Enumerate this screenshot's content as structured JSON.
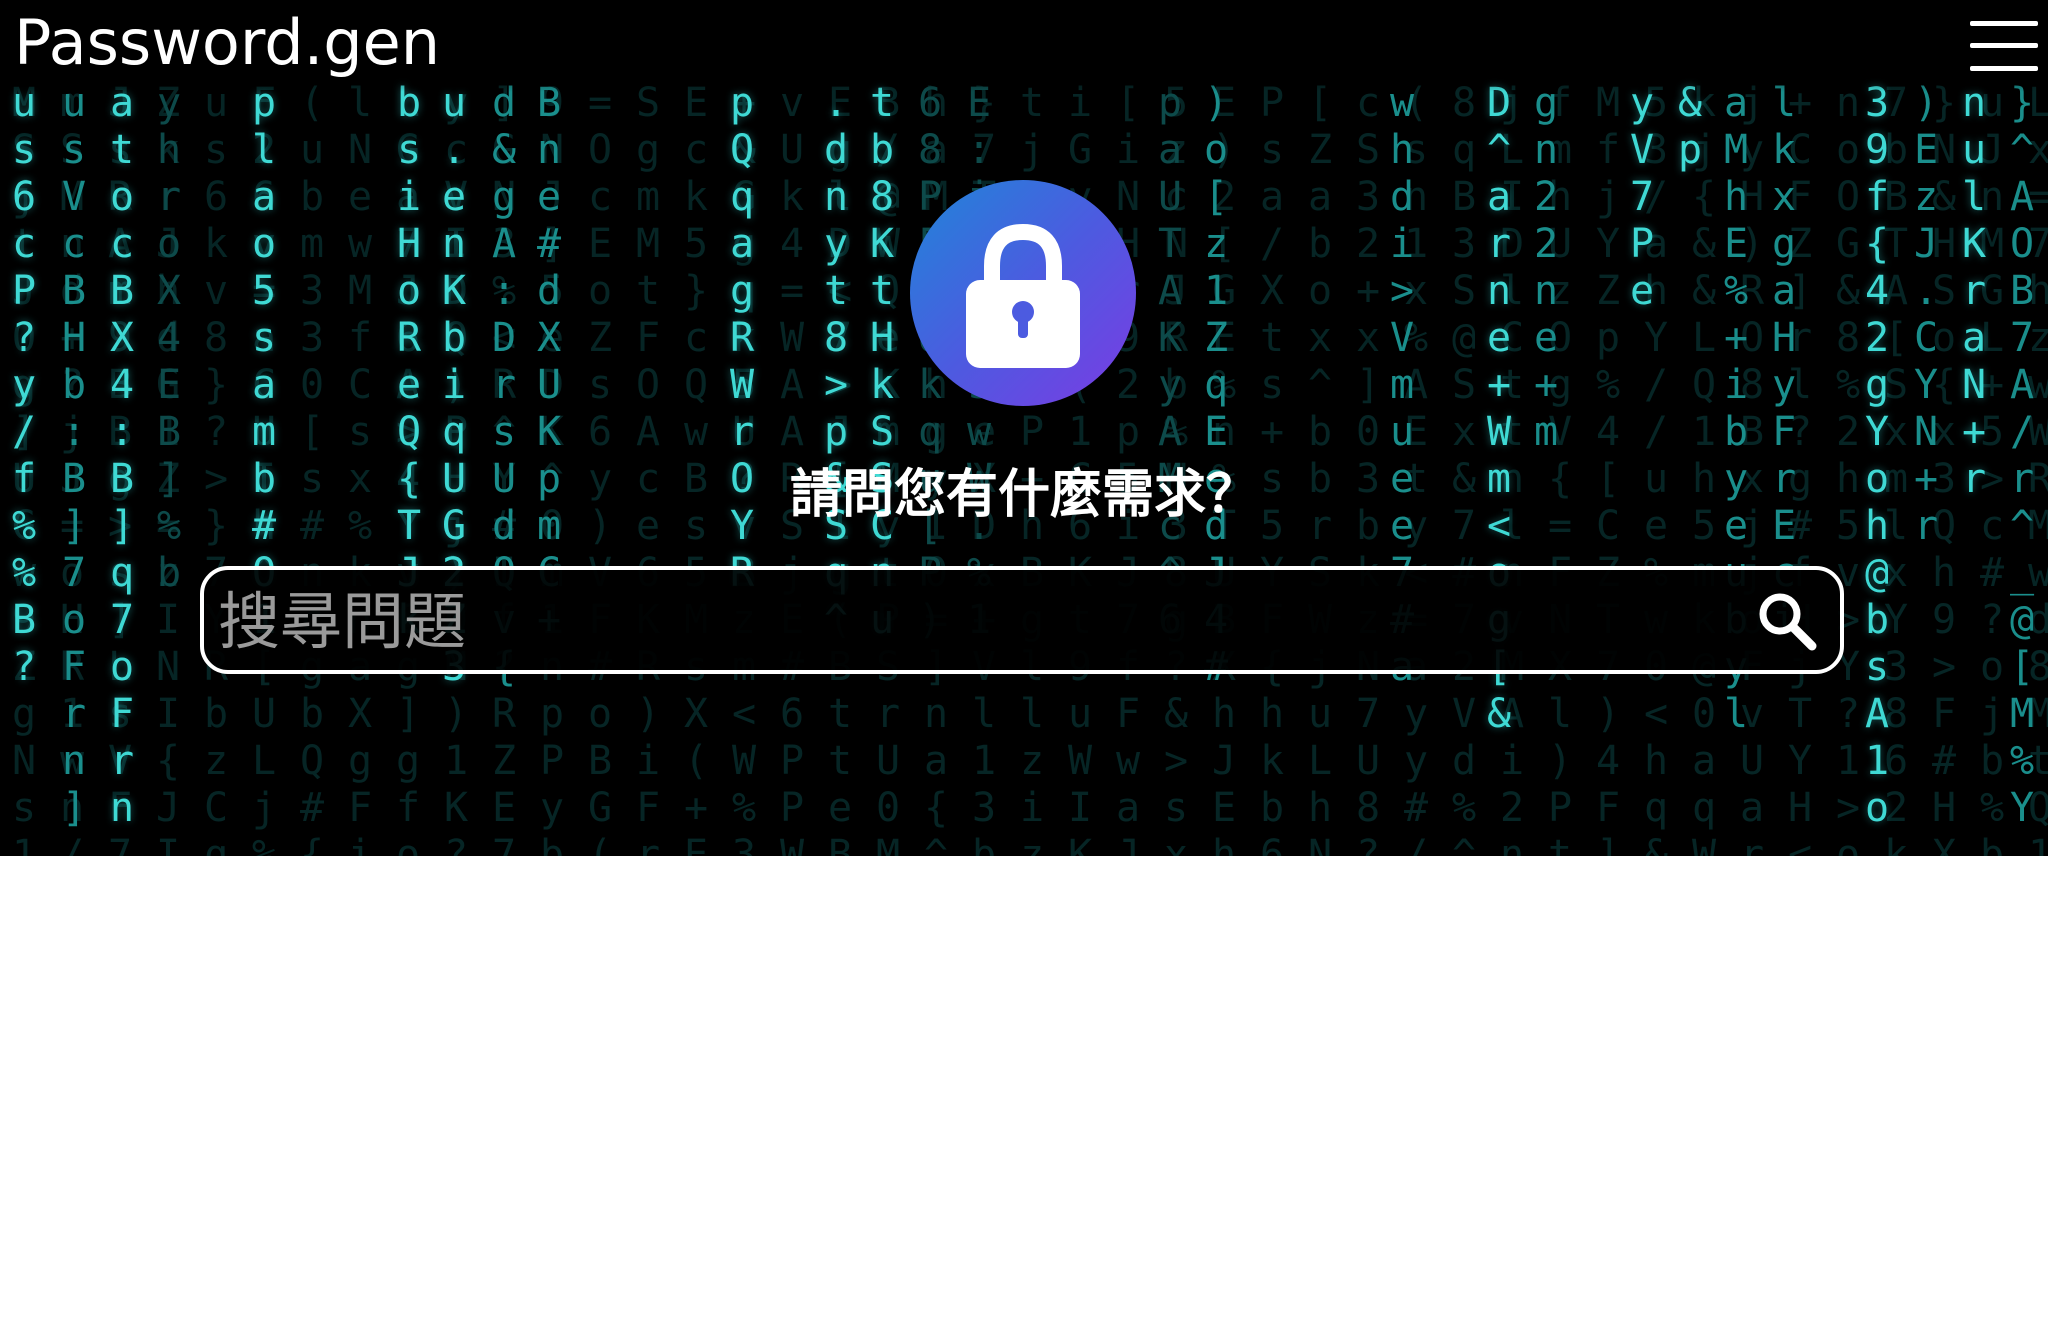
{
  "header": {
    "logo": "Password.gen",
    "menu_icon": "hamburger-menu-icon"
  },
  "hero": {
    "lock_icon": "padlock-icon",
    "question": "請問您有什麼需求？"
  },
  "search": {
    "placeholder": "搜尋問題",
    "value": "",
    "icon": "search-icon"
  },
  "colors": {
    "background": "#000000",
    "matrix_text": "#3fd9d4",
    "lock_gradient_start": "#1f86d8",
    "lock_gradient_end": "#7b3be4",
    "page_below": "#ffffff"
  },
  "matrix_columns": [
    {
      "chars": "u\ns\n6\nc\nP\n?\ny\n/\nf\n%\n%\nB\n?"
    },
    {
      "chars": "u\ns\nV\nc\nB\nH\nb\n:\nB\n]\n7\no\nF\nr\nn\n]"
    },
    {
      "chars": "a\nt\no\nc\nB\nX\n4\n:\nB\n]\nq\n7\no\nF\nr\nn"
    },
    {
      "chars": "y\nh\nr\no\nX\n4\nE\nB\n]\n%\nb"
    },
    {
      "chars": "p\nl\na\no\n5\ns\na\nm\nb\n#\nO\n1"
    },
    {
      "chars": "b\ns\ni\nH\no\nR\ne\nQ\n{\nT\nJ\nk"
    },
    {
      "chars": "u\n.\ne\nn\nK\nb\ni\nq\nU\nG\n2\nZ\n3"
    },
    {
      "chars": "d\n&\ng\nA\n:\nD\nr\ns\nU\nd\nQ\nv\n{"
    },
    {
      "chars": "B\nn\ne\n#\nd\nX\nU\nK\np\nm\nC\n+"
    },
    {
      "chars": "p\nQ\nq\na\ng\nR\nW\nr\nO\nY\nR"
    },
    {
      "chars": ".\nd\nn\ny\nt\n8\n>\np\n&\nS\nq\n^"
    },
    {
      "chars": "t\nb\n8\nK\nt\nH\nk\nS\nS\nC\nn\nu"
    },
    {
      "chars": "6\n8\nP\nF\ne\nd\nk\nq\nu\n[\nP\n)"
    },
    {
      "chars": "E\n:\ni\nw\na\nU\ns\nw\nW\n.\n%\n1"
    },
    {
      "chars": "p\na\nU\nT\nA\nK\ny\nA\nM\nc\n^\n6"
    },
    {
      "chars": ")\no\n[\nz\n1\nZ\nq\nE\ne\nd\nJ\n4\n#"
    },
    {
      "chars": "w\nh\nd\ni\n>\nV\nm\nu\ne\ne\n7\n#\na"
    },
    {
      "chars": "D\n^\na\nr\nn\ne\n+\nW\nm\n<\no\ng\n[\n&"
    },
    {
      "chars": "g\nn\n2\n2\nn\ne\n+\nm"
    },
    {
      "chars": "y\nV\n7\nP\ne"
    },
    {
      "chars": "&\np"
    },
    {
      "chars": "a\nM\nh\nE\n%\n+\ni\nb\ny\ne\nu\nb\ny\nl"
    },
    {
      "chars": "l\nk\nx\ng\na\nH\ny\nF\nr\nE\nc\ni"
    },
    {
      "chars": "3\n9\nf\n{\n4\n2\ng\nY\no\nh\n@\nb\ns\nA\n1\no"
    },
    {
      "chars": ")\nE\nz\nJ\n.\nC\nY\nN\n+\nr"
    },
    {
      "chars": "n\nu\nl\nK\nr\na\nN\n+\nr"
    },
    {
      "chars": "}\n^\nA\nO\nB\n7\nA\n/\nr\n^\n_\n@\n[\nM\n%\nY"
    }
  ]
}
